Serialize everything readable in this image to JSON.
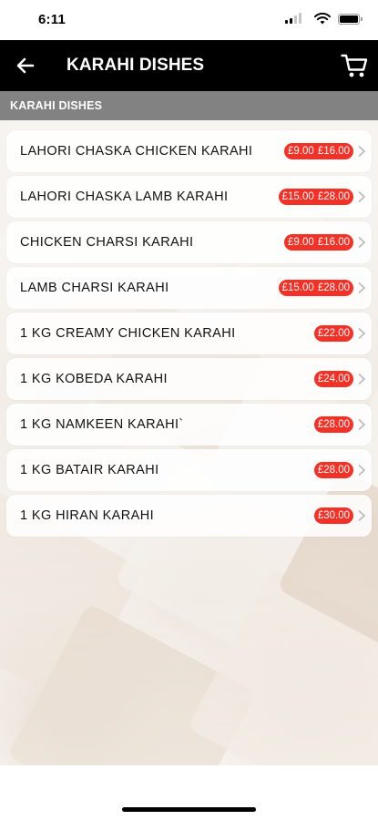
{
  "status_bar": {
    "time": "6:11",
    "icons": [
      "cellular-signal-icon",
      "wifi-icon",
      "battery-icon"
    ]
  },
  "header": {
    "back_icon": "arrow-left-icon",
    "title": "KARAHI DISHES",
    "cart_icon": "shopping-cart-icon"
  },
  "section": {
    "label": "KARAHI DISHES"
  },
  "menu_items": [
    {
      "name": "LAHORI CHASKA CHICKEN KARAHI",
      "prices": [
        "£9.00",
        "£16.00"
      ]
    },
    {
      "name": "LAHORI CHASKA LAMB KARAHI",
      "prices": [
        "£15.00",
        "£28.00"
      ]
    },
    {
      "name": "CHICKEN CHARSI KARAHI",
      "prices": [
        "£9.00",
        "£16.00"
      ]
    },
    {
      "name": "LAMB CHARSI KARAHI",
      "prices": [
        "£15.00",
        "£28.00"
      ]
    },
    {
      "name": "1 KG CREAMY CHICKEN KARAHI",
      "prices": [
        "£22.00"
      ]
    },
    {
      "name": "1 KG KOBEDA KARAHI",
      "prices": [
        "£24.00"
      ]
    },
    {
      "name": "1 KG NAMKEEN KARAHI`",
      "prices": [
        "£28.00"
      ]
    },
    {
      "name": "1 KG BATAIR KARAHI",
      "prices": [
        "£28.00"
      ]
    },
    {
      "name": "1 KG HIRAN KARAHI",
      "prices": [
        "£30.00"
      ]
    }
  ],
  "colors": {
    "header_bg": "#000000",
    "price_badge": "#f33126",
    "section_strip": "#696969"
  }
}
